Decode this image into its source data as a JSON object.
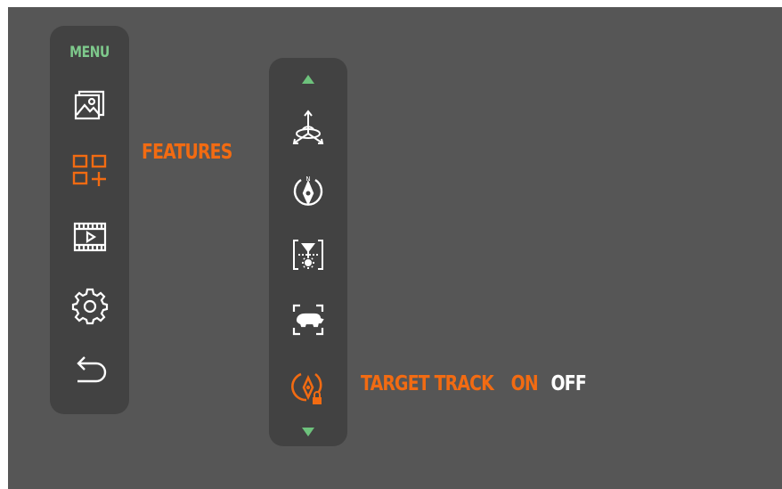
{
  "colors": {
    "background": "#565656",
    "panel": "#424242",
    "icon": "#ffffff",
    "active": "#f26b12",
    "menu_title": "#7ec98c",
    "arrow": "#6dc27c",
    "off": "#ffffff"
  },
  "menu": {
    "title": "MENU",
    "items": [
      {
        "icon": "gallery-icon",
        "active": false
      },
      {
        "icon": "features-grid-plus-icon",
        "active": true
      },
      {
        "icon": "video-icon",
        "active": false
      },
      {
        "icon": "gear-icon",
        "active": false
      },
      {
        "icon": "back-arrow-icon",
        "active": false
      }
    ]
  },
  "features": {
    "label": "FEATURES",
    "items": [
      {
        "icon": "axis-gyroscope-icon",
        "active": false
      },
      {
        "icon": "compass-icon",
        "active": false
      },
      {
        "icon": "focus-brightness-icon",
        "active": false
      },
      {
        "icon": "animal-detect-icon",
        "active": false
      },
      {
        "icon": "target-track-lock-icon",
        "active": true
      }
    ]
  },
  "target_track": {
    "label": "TARGET TRACK",
    "on": "ON",
    "off": "OFF",
    "selected": "ON"
  }
}
